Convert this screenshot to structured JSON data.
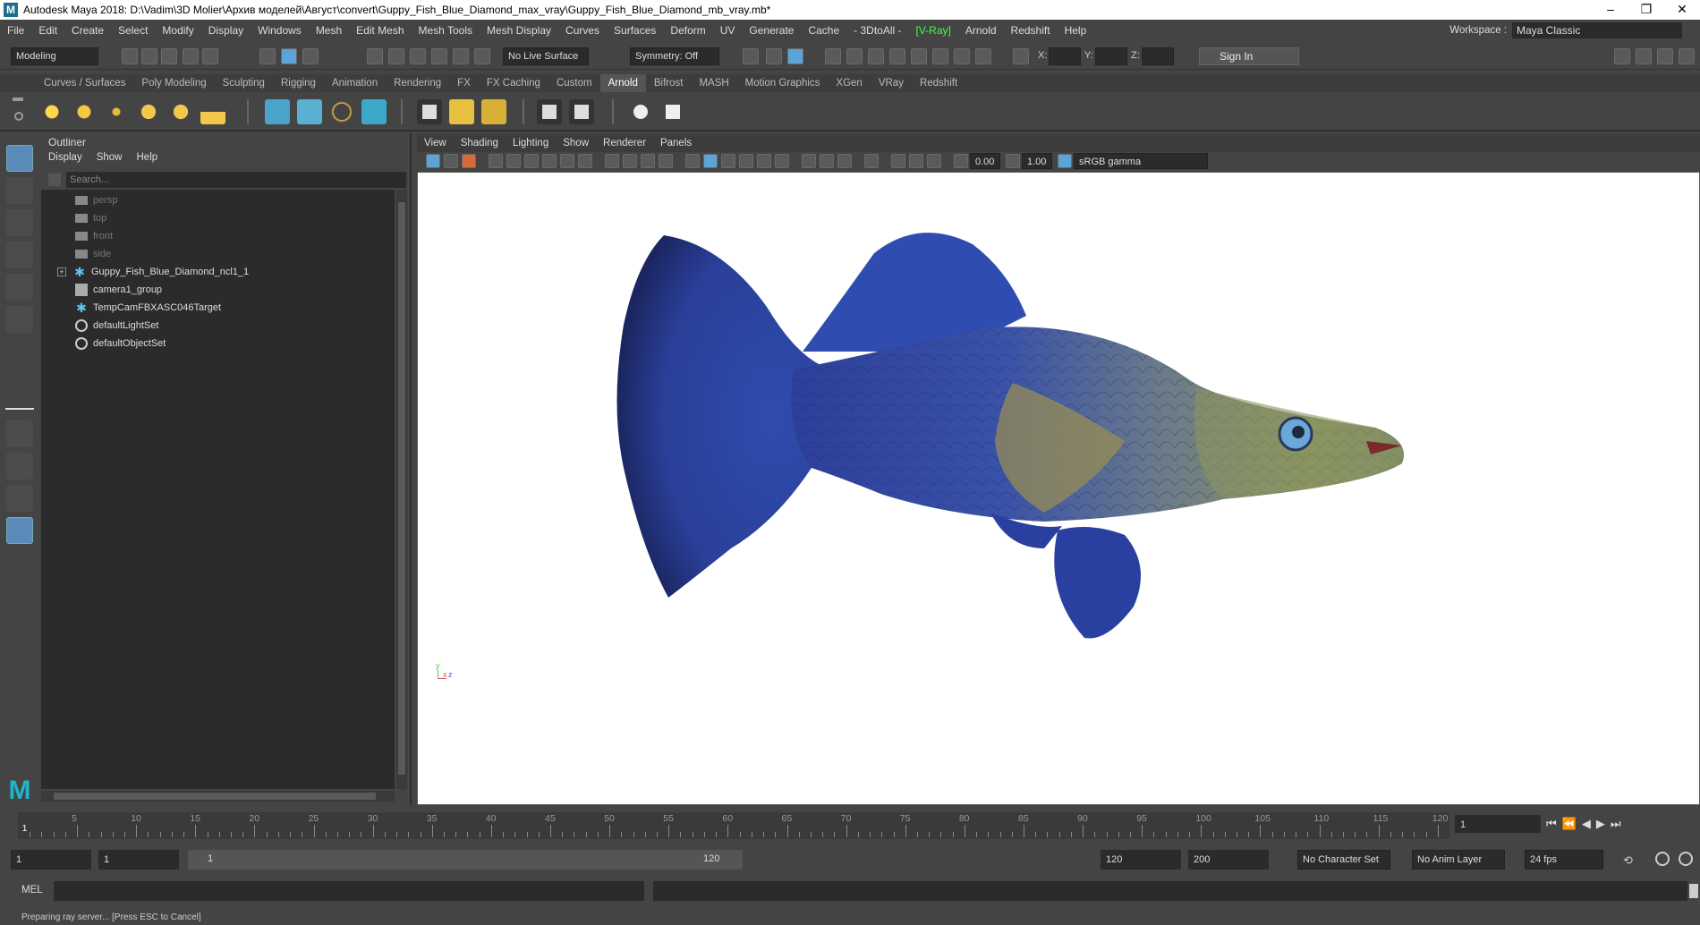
{
  "window": {
    "title": "Autodesk Maya 2018: D:\\Vadim\\3D Molier\\Архив моделей\\Август\\convert\\Guppy_Fish_Blue_Diamond_max_vray\\Guppy_Fish_Blue_Diamond_mb_vray.mb*"
  },
  "menubar": {
    "items": [
      "File",
      "Edit",
      "Create",
      "Select",
      "Modify",
      "Display",
      "Windows",
      "Mesh",
      "Edit Mesh",
      "Mesh Tools",
      "Mesh Display",
      "Curves",
      "Surfaces",
      "Deform",
      "UV",
      "Generate",
      "Cache",
      "- 3DtoAll -",
      "[V-Ray]",
      "Arnold",
      "Redshift",
      "Help"
    ]
  },
  "workspace": {
    "label": "Workspace :",
    "value": "Maya Classic"
  },
  "statusline": {
    "mode": "Modeling",
    "live_surface": "No Live Surface",
    "symmetry": "Symmetry: Off",
    "x_label": "X:",
    "y_label": "Y:",
    "z_label": "Z:",
    "sign_in": "Sign In"
  },
  "shelf": {
    "tabs": [
      "Curves / Surfaces",
      "Poly Modeling",
      "Sculpting",
      "Rigging",
      "Animation",
      "Rendering",
      "FX",
      "FX Caching",
      "Custom",
      "Arnold",
      "Bifrost",
      "MASH",
      "Motion Graphics",
      "XGen",
      "VRay",
      "Redshift"
    ],
    "active": "Arnold"
  },
  "outliner": {
    "title": "Outliner",
    "menu": [
      "Display",
      "Show",
      "Help"
    ],
    "search_placeholder": "Search...",
    "items": [
      {
        "label": "persp",
        "icon": "camera-icon",
        "dim": true
      },
      {
        "label": "top",
        "icon": "camera-icon",
        "dim": true
      },
      {
        "label": "front",
        "icon": "camera-icon",
        "dim": true
      },
      {
        "label": "side",
        "icon": "camera-icon",
        "dim": true
      },
      {
        "label": "Guppy_Fish_Blue_Diamond_ncl1_1",
        "icon": "joint-icon",
        "dim": false,
        "expandable": true
      },
      {
        "label": "camera1_group",
        "icon": "group-icon",
        "dim": false
      },
      {
        "label": "TempCamFBXASC046Target",
        "icon": "joint-icon",
        "dim": false
      },
      {
        "label": "defaultLightSet",
        "icon": "set-icon",
        "dim": false
      },
      {
        "label": "defaultObjectSet",
        "icon": "set-icon",
        "dim": false
      }
    ]
  },
  "viewport": {
    "menu": [
      "View",
      "Shading",
      "Lighting",
      "Show",
      "Renderer",
      "Panels"
    ],
    "exposure": "0.00",
    "gamma": "1.00",
    "color_space": "sRGB gamma",
    "axis": {
      "y": "y",
      "x": "x",
      "z": "z"
    }
  },
  "timeline": {
    "ticks": [
      5,
      10,
      15,
      20,
      25,
      30,
      35,
      40,
      45,
      50,
      55,
      60,
      65,
      70,
      75,
      80,
      85,
      90,
      95,
      100,
      105,
      110,
      115,
      120
    ],
    "current_frame": "1",
    "current_marker": "1"
  },
  "range": {
    "start": "1",
    "anim_start": "1",
    "slider_start": "1",
    "slider_end": "120",
    "anim_end": "120",
    "end": "200",
    "character_set": "No Character Set",
    "anim_layer": "No Anim Layer",
    "fps": "24 fps"
  },
  "commandline": {
    "lang": "MEL"
  },
  "helpline": {
    "text": "Preparing ray server... [Press ESC to Cancel]"
  },
  "colors": {
    "accent": "#5ca3d8",
    "vray_green": "#44ff44",
    "bg": "#444444",
    "field": "#2b2b2b"
  }
}
